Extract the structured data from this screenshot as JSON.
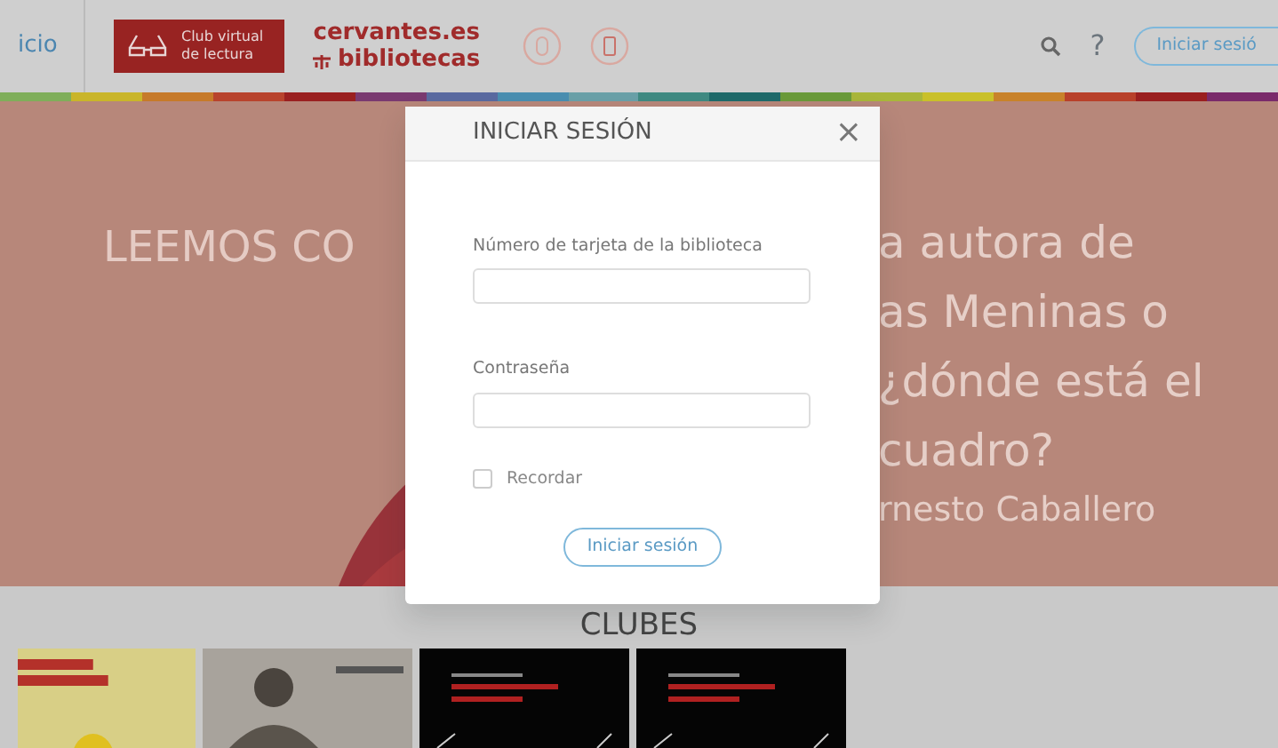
{
  "navbar": {
    "home_link": "icio",
    "club_logo": {
      "line1": "Club virtual",
      "line2": "de lectura"
    },
    "brand": {
      "line1": "cervantes.es",
      "line2": "bibliotecas"
    },
    "help": "?",
    "login_button": "Iniciar sesió"
  },
  "hero": {
    "left_text": "LEEMOS CO",
    "right_lines": [
      "a autora de",
      "as Meninas o",
      "¿dónde está el",
      "cuadro?"
    ],
    "author": "rnesto Caballero"
  },
  "clubs": {
    "heading": "CLUBES"
  },
  "modal": {
    "title": "INICIAR SESIÓN",
    "close": "×",
    "fields": [
      {
        "label": "Número de tarjeta de la biblioteca"
      },
      {
        "label": "Contraseña"
      }
    ],
    "remember": {
      "label": "Recordar",
      "checked": false
    },
    "submit": "Iniciar sesión"
  }
}
